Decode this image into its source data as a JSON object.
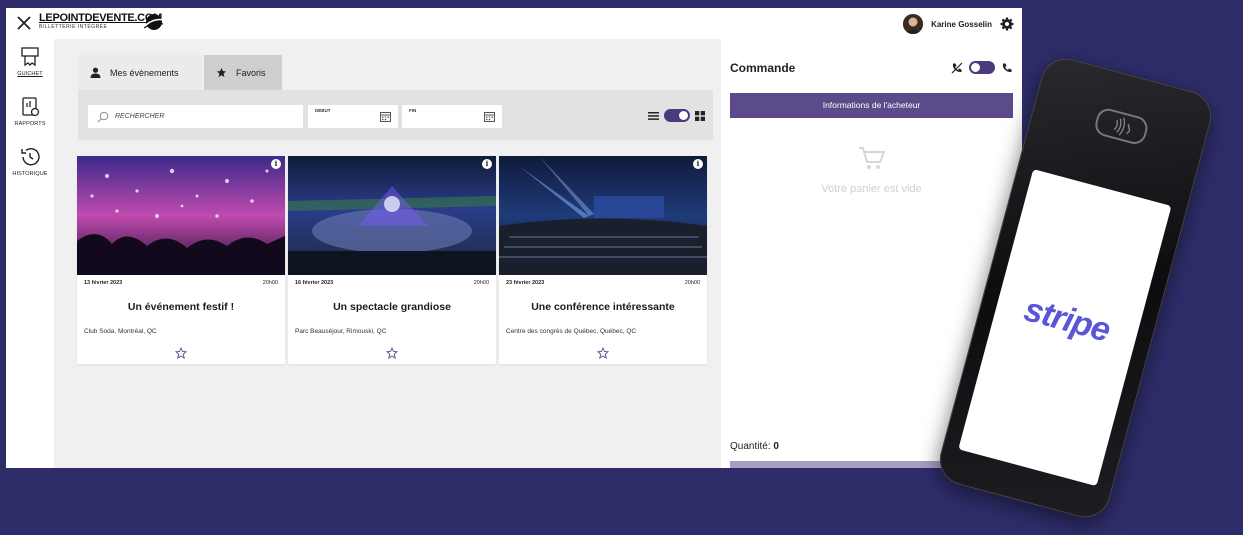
{
  "topbar": {
    "logo_main": "LEPOINTDEVENTE.COM",
    "logo_sub": "BILLETTERIE INTÉGRÉE",
    "user_name": "Karine Gosselin"
  },
  "rail": {
    "items": [
      {
        "label": "GUICHET",
        "icon": "ticket-icon"
      },
      {
        "label": "RAPPORTS",
        "icon": "report-icon"
      },
      {
        "label": "HISTORIQUE",
        "icon": "history-icon"
      }
    ]
  },
  "tabs": [
    {
      "label": "Mes évènements",
      "icon": "person-icon"
    },
    {
      "label": "Favoris",
      "icon": "star-icon"
    }
  ],
  "filters": {
    "search_placeholder": "RECHERCHER",
    "start_label": "DÉBUT",
    "end_label": "FIN"
  },
  "events": [
    {
      "date": "13 février 2023",
      "time": "20h00",
      "title": "Un événement festif !",
      "venue": "Club Soda, Montréal, QC"
    },
    {
      "date": "16 février 2023",
      "time": "20h00",
      "title": "Un spectacle grandiose",
      "venue": "Parc Beauséjour, Rimouski, QC"
    },
    {
      "date": "23 février 2023",
      "time": "20h00",
      "title": "Une conférence intéressante",
      "venue": "Centre des congrès de Québec, Québec, QC"
    }
  ],
  "order": {
    "title": "Commande",
    "buyer_button": "Informations de l'acheteur",
    "empty_cart": "Votre panier est vide",
    "quantity_label": "Quantité:",
    "quantity_value": "0"
  },
  "device": {
    "brand": "stripe"
  },
  "colors": {
    "accent": "#5b4b8a",
    "toggle": "#4b3a7e",
    "background": "#2e2d6a"
  }
}
